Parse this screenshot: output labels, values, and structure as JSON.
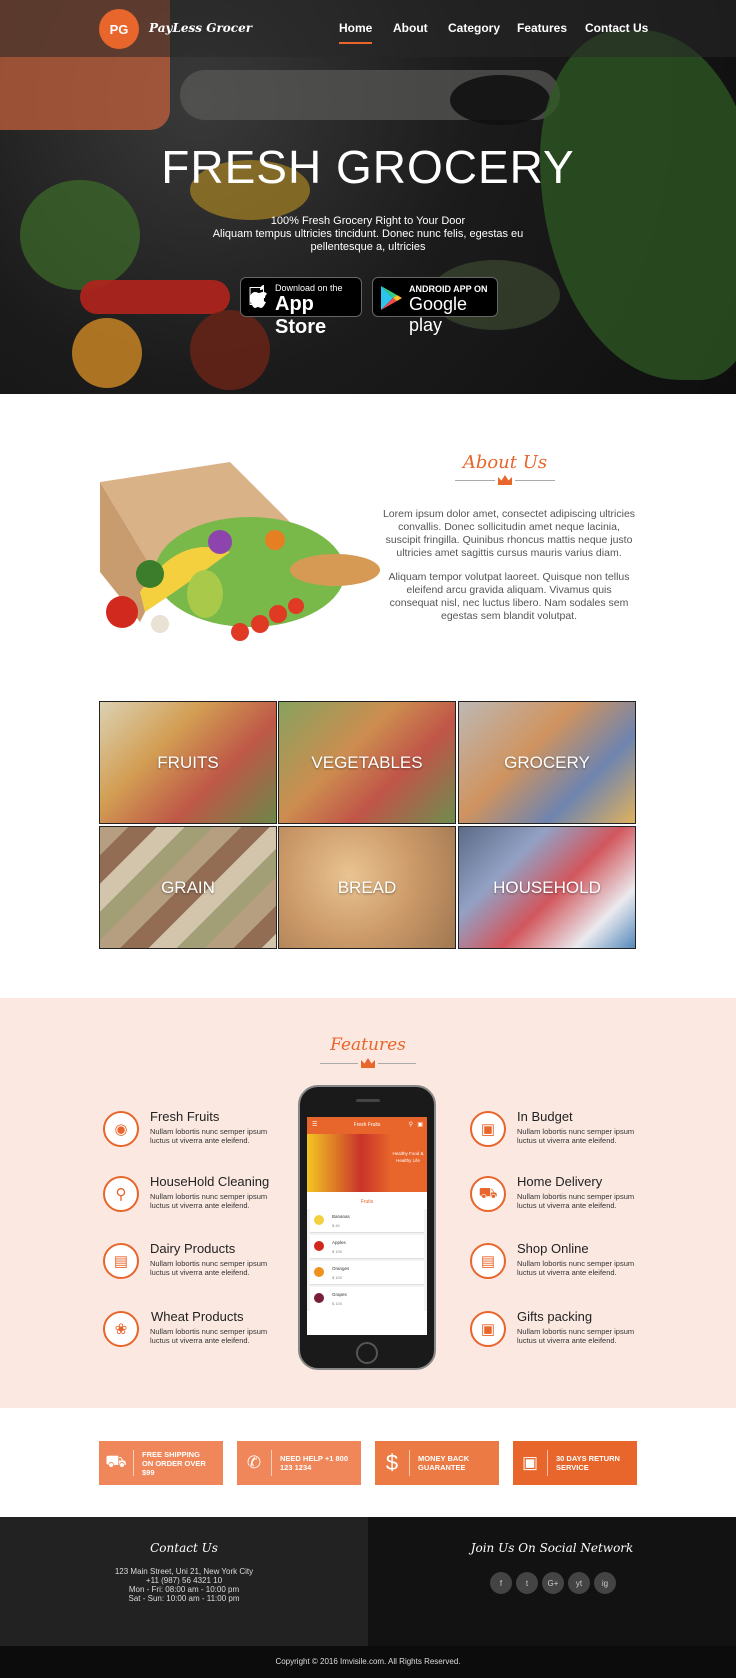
{
  "brand": {
    "logo_mark": "PG",
    "name": "PayLess Grocer",
    "accent": "#e8652b"
  },
  "nav": {
    "items": [
      "Home",
      "About",
      "Category",
      "Features",
      "Contact Us"
    ],
    "active": "Home"
  },
  "hero": {
    "title": "FRESH GROCERY",
    "tagline": "100% Fresh Grocery Right to Your Door",
    "text": "Aliquam tempus ultricies tincidunt. Donec nunc felis, egestas eu pellentesque a, ultricies",
    "appstore": {
      "small": "Download on the",
      "big": "App Store"
    },
    "playstore": {
      "small": "ANDROID APP ON",
      "big": "Google play"
    }
  },
  "about": {
    "heading": "About Us",
    "para1": "Lorem ipsum dolor amet, consectet adipiscing ultricies convallis. Donec sollicitudin amet neque lacinia, suscipit fringilla. Quinibus rhoncus mattis neque justo ultricies amet sagittis cursus mauris varius diam.",
    "para2": "Aliquam tempor volutpat laoreet. Quisque non tellus eleifend arcu gravida aliquam. Vivamus quis consequat nisl, nec luctus libero. Nam sodales sem egestas sem blandit volutpat."
  },
  "categories": [
    "FRUITS",
    "VEGETABLES",
    "GROCERY",
    "GRAIN",
    "BREAD",
    "HOUSEHOLD"
  ],
  "features": {
    "heading": "Features",
    "desc": "Nullam lobortis nunc semper ipsum luctus ut viverra ante eleifend.",
    "left": [
      {
        "title": "Fresh Fruits",
        "icon": "fruit-bowl-icon"
      },
      {
        "title": "HouseHold Cleaning",
        "icon": "spray-bottle-icon"
      },
      {
        "title": "Dairy Products",
        "icon": "milk-jar-icon"
      },
      {
        "title": "Wheat Products",
        "icon": "wheat-basket-icon"
      }
    ],
    "right": [
      {
        "title": "In Budget",
        "icon": "wallet-icon"
      },
      {
        "title": "Home Delivery",
        "icon": "truck-icon"
      },
      {
        "title": "Shop Online",
        "icon": "basket-icon"
      },
      {
        "title": "Gifts packing",
        "icon": "gift-icon"
      }
    ],
    "phone": {
      "header": "Fresh Fruits",
      "banner": "Healthy Food & Healthy Life",
      "section": "Fruits",
      "items": [
        {
          "name": "Bananas",
          "price": "$ 40"
        },
        {
          "name": "Apples",
          "price": "$ 100"
        },
        {
          "name": "Oranges",
          "price": "$ 100"
        },
        {
          "name": "Grapes",
          "price": "$ 100"
        }
      ]
    }
  },
  "promos": [
    {
      "text": "FREE SHIPPING ON ORDER OVER $99",
      "icon": "truck-icon",
      "color": "#f0875a"
    },
    {
      "text": "NEED HELP +1 800 123 1234",
      "icon": "phone-icon",
      "color": "#f0875a"
    },
    {
      "text": "MONEY BACK GUARANTEE",
      "icon": "dollar-icon",
      "color": "#eb7a45"
    },
    {
      "text": "30 DAYS RETURN SERVICE",
      "icon": "briefcase-icon",
      "color": "#e8652b"
    }
  ],
  "footer": {
    "contact_heading": "Contact Us",
    "address": "123 Main Street, Uni 21, New York City",
    "phone": "+11 (987) 56 4321 10",
    "hours1": "Mon - Fri: 08:00 am - 10:00 pm",
    "hours2": "Sat - Sun: 10:00 am - 11:00 pm",
    "social_heading": "Join Us On Social Network",
    "social": [
      "f",
      "t",
      "G+",
      "yt",
      "ig"
    ],
    "copyright": "Copyright © 2016 Imvisile.com. All Rights Reserved."
  }
}
